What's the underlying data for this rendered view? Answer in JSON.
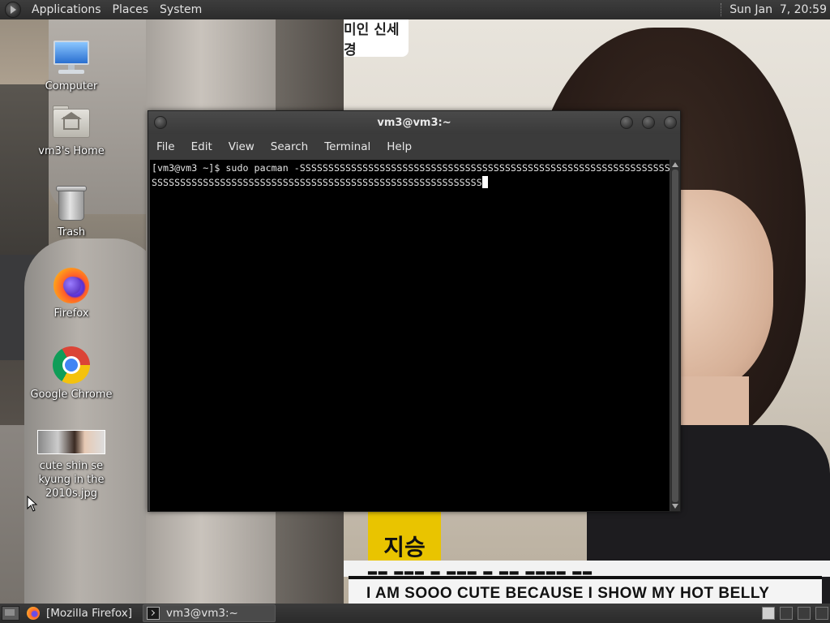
{
  "top_panel": {
    "menus": [
      "Applications",
      "Places",
      "System"
    ],
    "clock": "Sun Jan  7, 20:59"
  },
  "wallpaper": {
    "logo_text": "미인 신세경",
    "box_text": "지승",
    "banner_top": "▂▂ ▂▂▂ ▂ ▂▂▂ ▂ ▂▂ ▂▂▂▂ ▂▂",
    "banner_text": "I AM SOOO CUTE BECAUSE I SHOW MY HOT BELLY BUTTON"
  },
  "desktop_icons": [
    {
      "label": "Computer",
      "icon": "computer-icon"
    },
    {
      "label": "vm3's Home",
      "icon": "home-folder-icon"
    },
    {
      "label": "Trash",
      "icon": "trash-icon"
    },
    {
      "label": "Firefox",
      "icon": "firefox-icon"
    },
    {
      "label": "Google Chrome",
      "icon": "chrome-icon"
    },
    {
      "label": "cute shin se kyung in the 2010s.jpg",
      "icon": "image-file-icon"
    }
  ],
  "terminal": {
    "title": "vm3@vm3:~",
    "menu": [
      "File",
      "Edit",
      "View",
      "Search",
      "Terminal",
      "Help"
    ],
    "prompt": "[vm3@vm3 ~]$ ",
    "command": "sudo pacman -SSSSSSSSSSSSSSSSSSSSSSSSSSSSSSSSSSSSSSSSSSSSSSSSSSSSSSSSSSSSSSSSSSSSSSSSSSSSSSSSSSSSSSSSSSSSSSSSSSSSSSSSSSSSSSSSSSSSSSSSSSS"
  },
  "taskbar": {
    "tasks": [
      {
        "label": "[Mozilla Firefox]",
        "icon": "firefox-icon",
        "active": false
      },
      {
        "label": "vm3@vm3:~",
        "icon": "terminal-icon",
        "active": true
      }
    ],
    "workspaces": 4
  },
  "colors": {
    "panel": "#2c2c2c",
    "terminal_bg": "#000000",
    "terminal_fg": "#e6e6e6",
    "window_frame": "#3b3b3b"
  }
}
